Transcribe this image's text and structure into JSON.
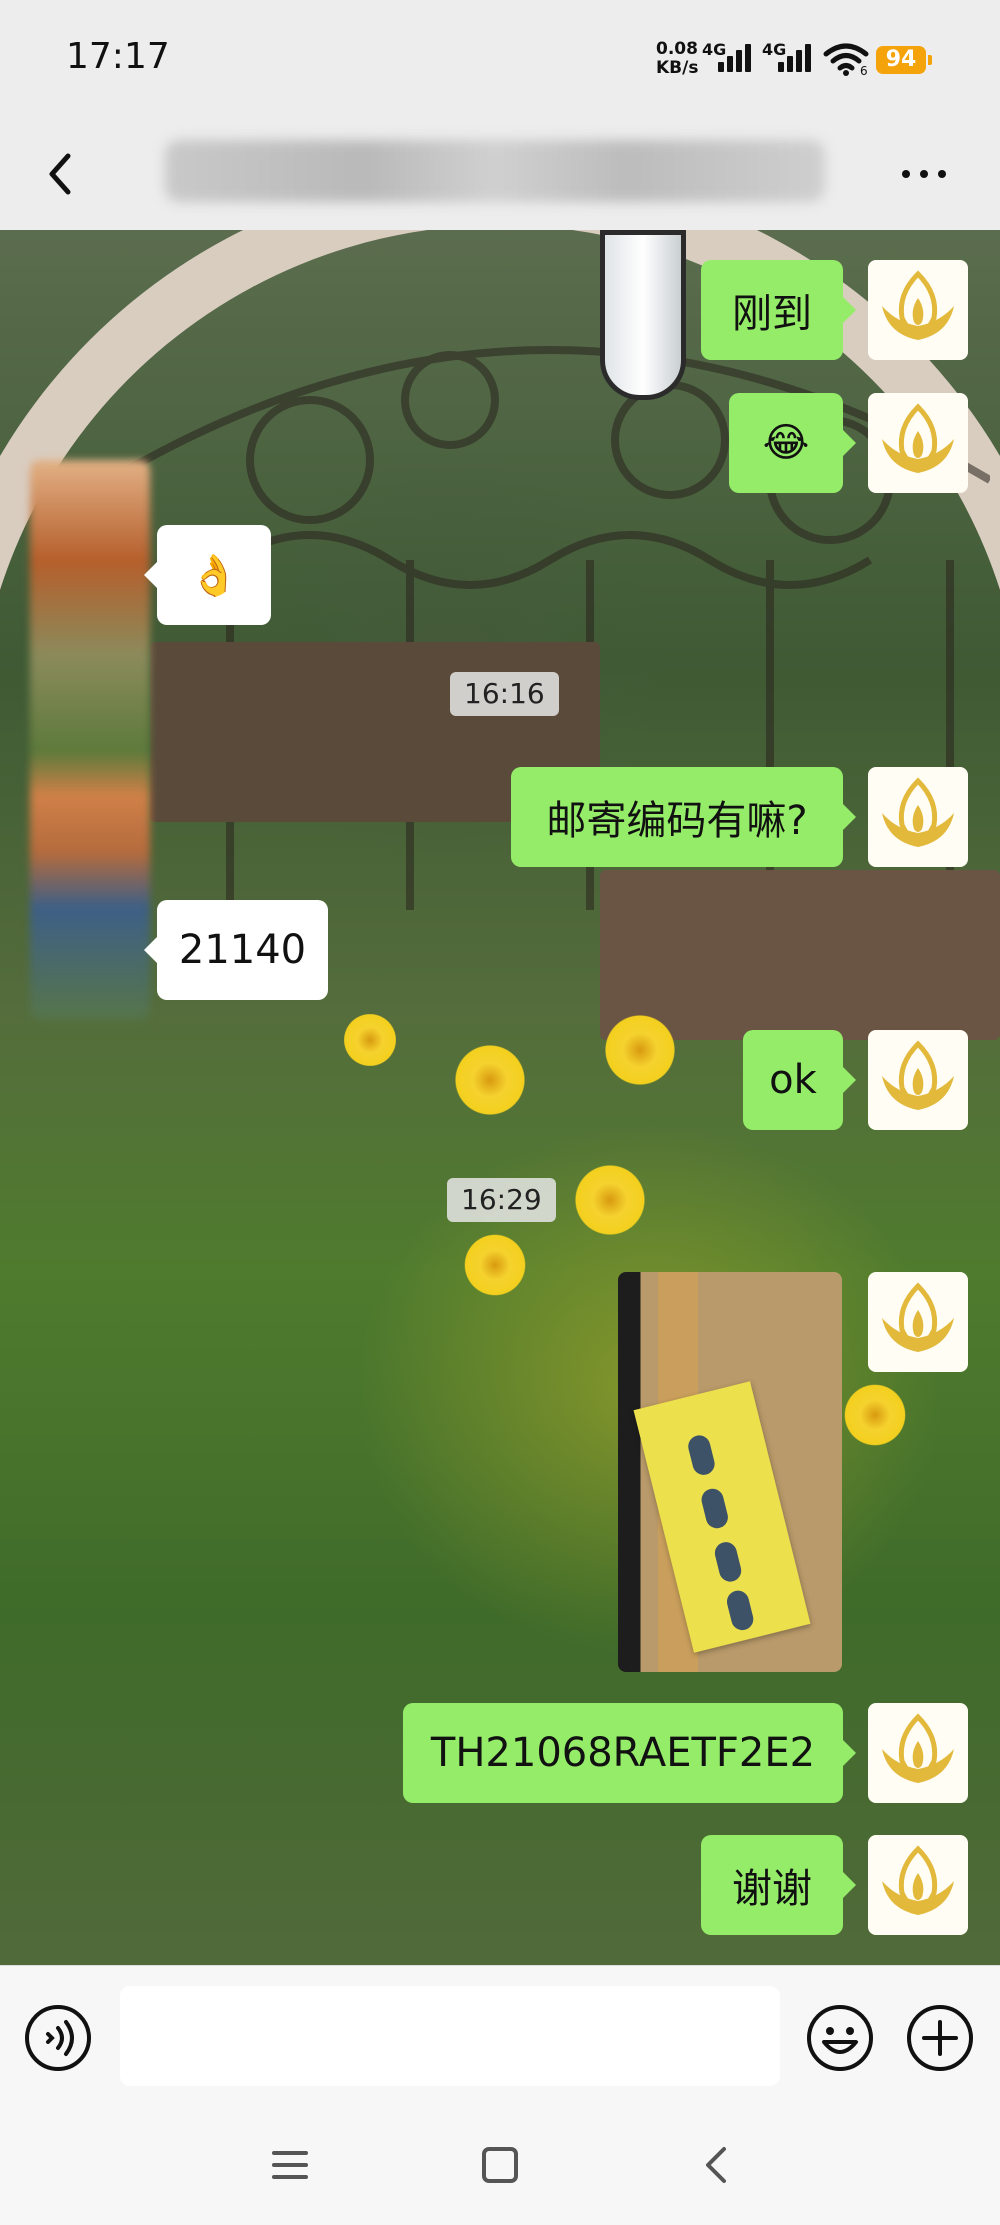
{
  "status_bar": {
    "time": "17:17",
    "net_speed_value": "0.08",
    "net_speed_unit": "KB/s",
    "signal1_label": "4G",
    "signal2_label": "4G",
    "wifi_label": "6",
    "battery": "94"
  },
  "header": {
    "title": ""
  },
  "messages": {
    "m1": {
      "side": "me",
      "text": "刚到"
    },
    "m2": {
      "side": "me",
      "text": "😂"
    },
    "m3": {
      "side": "them",
      "text": "👌"
    },
    "t1": "16:16",
    "m4": {
      "side": "me",
      "text": "邮寄编码有嘛?"
    },
    "m5": {
      "side": "them",
      "text": "21140"
    },
    "m6": {
      "side": "me",
      "text": "ok"
    },
    "t2": "16:29",
    "m7": {
      "side": "me",
      "type": "image"
    },
    "m8": {
      "side": "me",
      "text": "TH21068RAETF2E2"
    },
    "m9": {
      "side": "me",
      "text": "谢谢"
    }
  },
  "colors": {
    "my_bubble": "#95ec69",
    "their_bubble": "#ffffff",
    "battery": "#f5a30a",
    "avatar_gold": "#e2b93b"
  },
  "icons": {
    "back": "chevron-left-icon",
    "more": "ellipsis-icon",
    "voice": "voice-icon",
    "emoji": "smiley-icon",
    "plus": "plus-circle-icon",
    "avatar": "lotus-icon"
  }
}
